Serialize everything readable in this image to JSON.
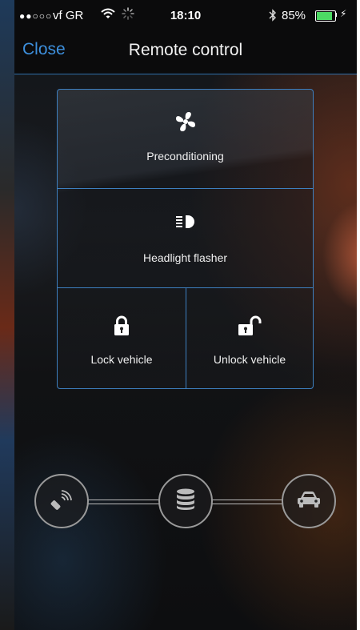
{
  "status_bar": {
    "signal": "●●○○○",
    "carrier": "vf GR",
    "time": "18:10",
    "battery_percent": "85%",
    "battery_level": 0.85
  },
  "nav": {
    "close_label": "Close",
    "title": "Remote control"
  },
  "controls": {
    "preconditioning": {
      "label": "Preconditioning",
      "icon": "fan-icon"
    },
    "headlight": {
      "label": "Headlight flasher",
      "icon": "headlight-icon"
    },
    "lock": {
      "label": "Lock vehicle",
      "icon": "lock-icon"
    },
    "unlock": {
      "label": "Unlock vehicle",
      "icon": "unlock-icon"
    }
  },
  "connection": {
    "nodes": [
      "remote-key-icon",
      "server-icon",
      "car-icon"
    ]
  },
  "colors": {
    "accent": "#3d8fdc",
    "border": "#3d7fbf"
  }
}
